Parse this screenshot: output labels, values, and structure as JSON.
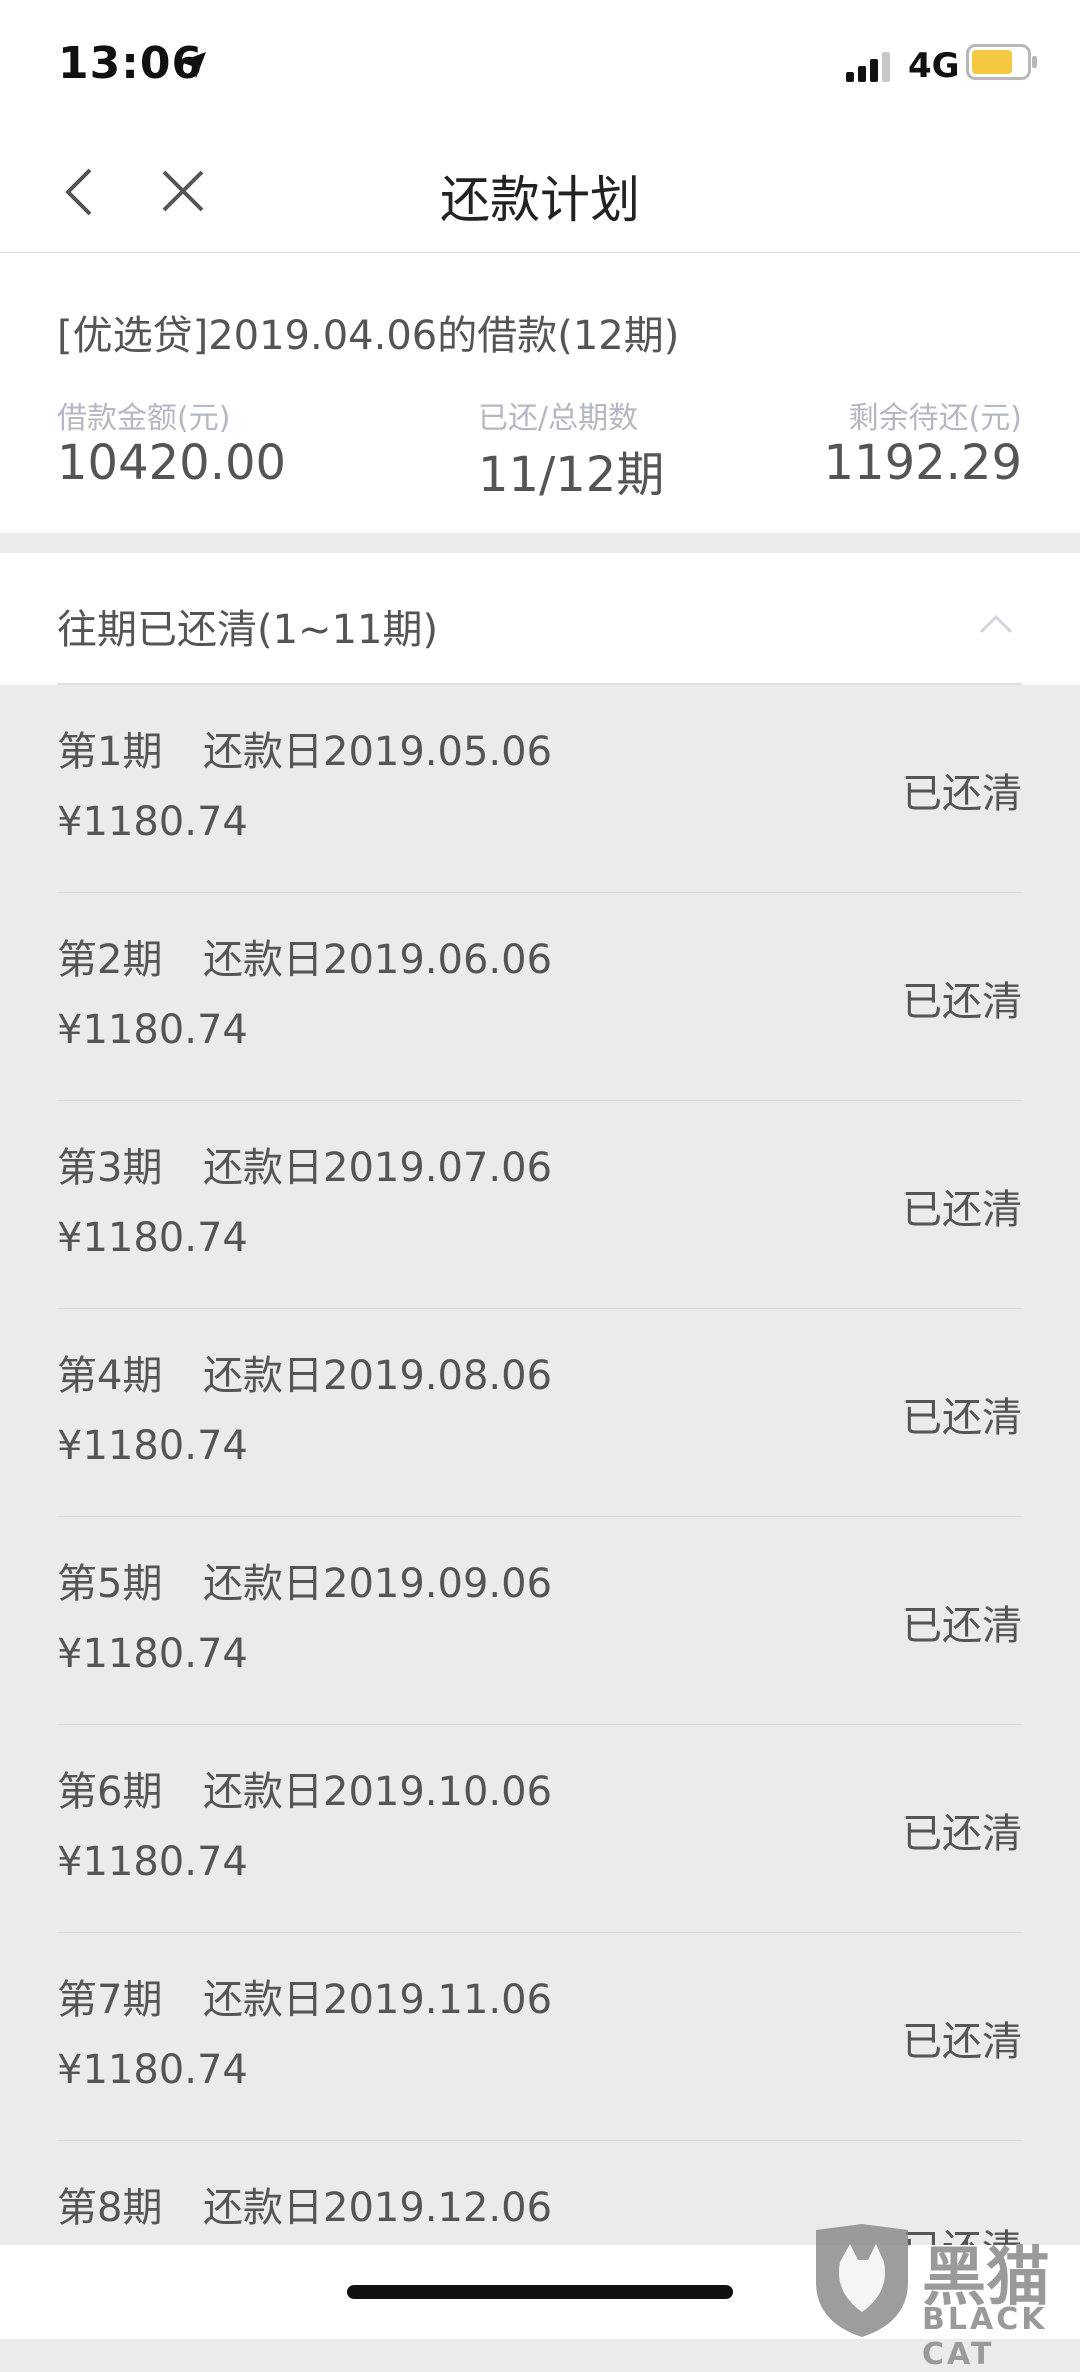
{
  "status_bar": {
    "time": "13:06",
    "network": "4G",
    "battery_color": "#f5c842"
  },
  "nav": {
    "title": "还款计划"
  },
  "summary": {
    "loan_title": "[优选贷]2019.04.06的借款(12期)",
    "loan_amount_label": "借款金额(元)",
    "loan_amount": "10420.00",
    "paid_total_label": "已还/总期数",
    "paid_total": "11/12期",
    "remaining_label": "剩余待还(元)",
    "remaining": "1192.29"
  },
  "section": {
    "title": "往期已还清(1~11期)",
    "expanded": true
  },
  "installments": [
    {
      "period": "第1期",
      "due": "还款日2019.05.06",
      "amount": "¥1180.74",
      "status": "已还清"
    },
    {
      "period": "第2期",
      "due": "还款日2019.06.06",
      "amount": "¥1180.74",
      "status": "已还清"
    },
    {
      "period": "第3期",
      "due": "还款日2019.07.06",
      "amount": "¥1180.74",
      "status": "已还清"
    },
    {
      "period": "第4期",
      "due": "还款日2019.08.06",
      "amount": "¥1180.74",
      "status": "已还清"
    },
    {
      "period": "第5期",
      "due": "还款日2019.09.06",
      "amount": "¥1180.74",
      "status": "已还清"
    },
    {
      "period": "第6期",
      "due": "还款日2019.10.06",
      "amount": "¥1180.74",
      "status": "已还清"
    },
    {
      "period": "第7期",
      "due": "还款日2019.11.06",
      "amount": "¥1180.74",
      "status": "已还清"
    },
    {
      "period": "第8期",
      "due": "还款日2019.12.06",
      "amount": "",
      "status": "已还清"
    }
  ],
  "watermark": {
    "cn_text": "黑猫",
    "en_text": "BLACK CAT"
  }
}
